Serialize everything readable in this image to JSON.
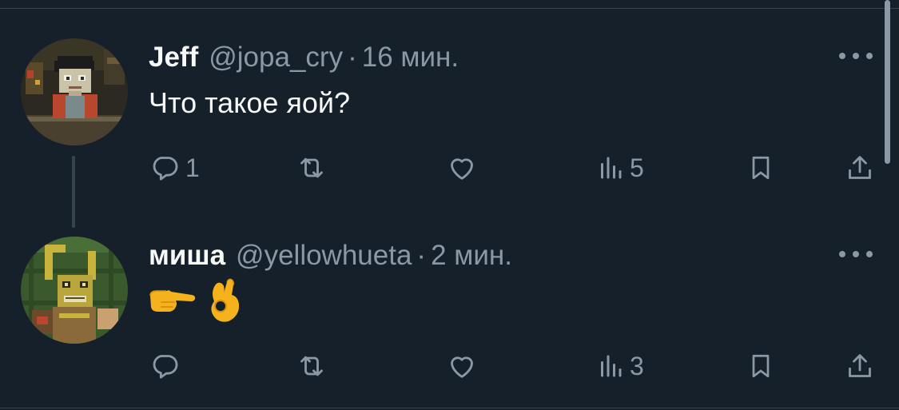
{
  "tweets": [
    {
      "display_name": "Jeff",
      "handle": "@jopa_cry",
      "separator": "·",
      "time": "16 мин.",
      "text": "Что такое яой?",
      "replies": "1",
      "retweets": "",
      "likes": "",
      "views": "5",
      "avatar_icon": "pixel-art-character-avatar"
    },
    {
      "display_name": "миша",
      "handle": "@yellowhueta",
      "separator": "·",
      "time": "2 мин.",
      "text": "👉👌",
      "replies": "",
      "retweets": "",
      "likes": "",
      "views": "3",
      "avatar_icon": "pixel-art-yellow-rabbit-avatar"
    }
  ],
  "icons": {
    "reply": "reply-icon",
    "retweet": "retweet-icon",
    "like": "heart-icon",
    "views": "views-icon",
    "bookmark": "bookmark-icon",
    "share": "share-icon",
    "more": "more-icon"
  },
  "colors": {
    "background": "#15202b",
    "text_primary": "#f7f9f9",
    "text_secondary": "#8b98a5",
    "divider": "#38444d"
  }
}
